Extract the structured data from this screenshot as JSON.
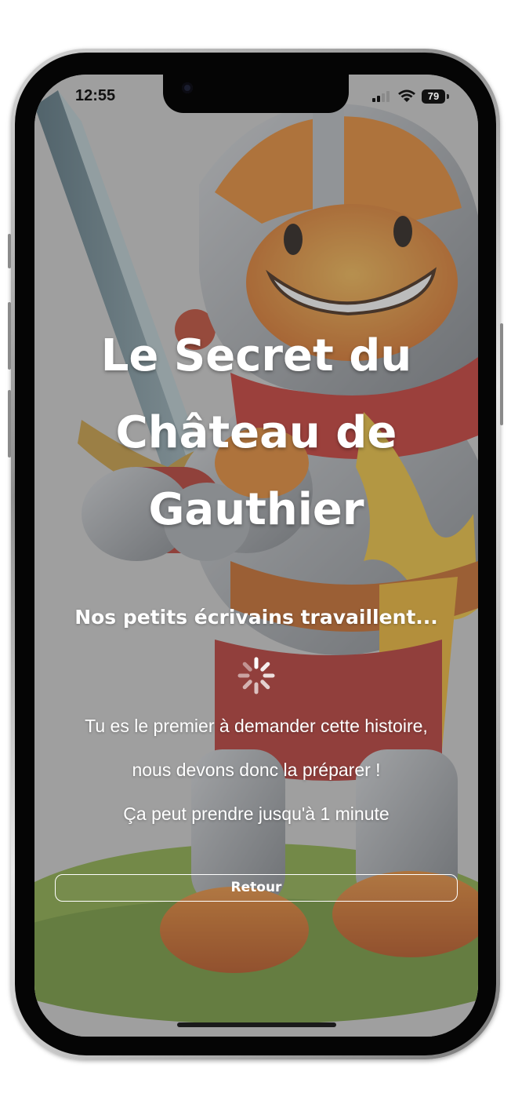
{
  "status_bar": {
    "time": "12:55",
    "battery_level": "79",
    "signal_icon": "cellular-signal-icon",
    "wifi_icon": "wifi-icon",
    "battery_icon": "battery-icon"
  },
  "main": {
    "title_lines": [
      "Le Secret du",
      "Château de",
      "Gauthier"
    ],
    "subtitle": "Nos petits écrivains travaillent...",
    "loading_icon": "spinner-icon",
    "message_lines": [
      "Tu es le premier à demander cette histoire,",
      "nous devons donc la préparer !",
      "Ça peut prendre jusqu'à 1 minute"
    ],
    "back_label": "Retour"
  },
  "colors": {
    "text": "#ffffff",
    "overlay": "#585858",
    "armor": "#9aa0a6",
    "orange": "#e8862a",
    "red": "#c8312b",
    "grass": "#7fa83a"
  }
}
